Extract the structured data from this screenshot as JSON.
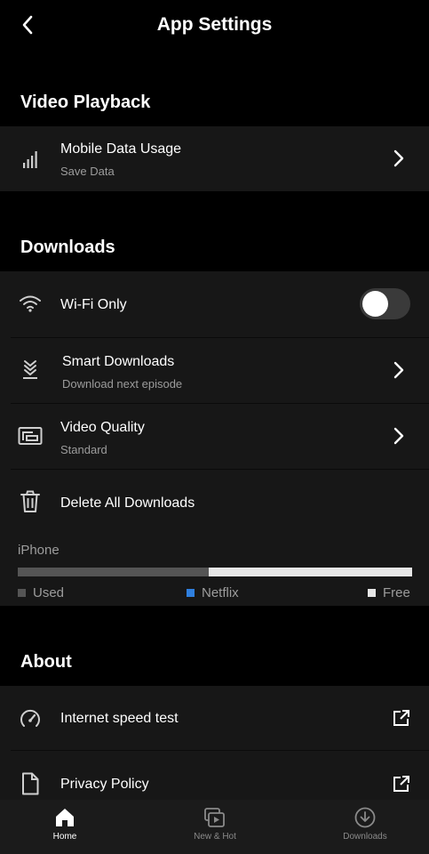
{
  "header": {
    "title": "App Settings",
    "back_icon": "chevron-left-icon"
  },
  "video_playback": {
    "title": "Video Playback",
    "mobile_data": {
      "label": "Mobile Data Usage",
      "sub": "Save Data",
      "icon": "signal-bars-icon"
    }
  },
  "downloads": {
    "title": "Downloads",
    "wifi_only": {
      "label": "Wi-Fi Only",
      "icon": "wifi-icon",
      "enabled": false
    },
    "smart_downloads": {
      "label": "Smart Downloads",
      "sub": "Download next episode",
      "icon": "smart-downloads-icon"
    },
    "video_quality": {
      "label": "Video Quality",
      "sub": "Standard",
      "icon": "video-quality-icon"
    },
    "delete_all": {
      "label": "Delete All Downloads",
      "icon": "trash-icon"
    },
    "storage": {
      "device": "iPhone",
      "used_fraction": 0.485,
      "netflix_fraction": 0.0,
      "legend": {
        "used": "Used",
        "netflix": "Netflix",
        "free": "Free"
      },
      "colors": {
        "used": "#555555",
        "netflix": "#2f7fde",
        "free": "#e6e6e6"
      }
    }
  },
  "about": {
    "title": "About",
    "speed_test": {
      "label": "Internet speed test",
      "icon": "speedometer-icon"
    },
    "privacy": {
      "label": "Privacy Policy",
      "icon": "document-icon"
    }
  },
  "tabbar": {
    "home": {
      "label": "Home",
      "icon": "home-icon",
      "active": true
    },
    "new_hot": {
      "label": "New & Hot",
      "icon": "new-hot-icon",
      "active": false
    },
    "downloads": {
      "label": "Downloads",
      "icon": "download-circle-icon",
      "active": false
    }
  }
}
